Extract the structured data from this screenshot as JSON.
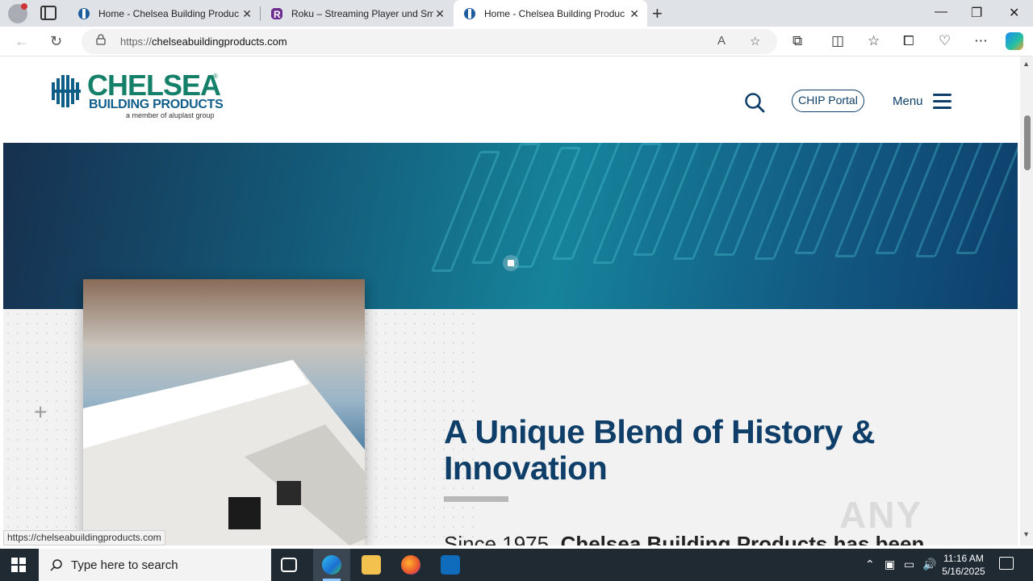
{
  "browser": {
    "tabs": [
      {
        "title": "Home - Chelsea Building Produc",
        "active": false
      },
      {
        "title": "Roku – Streaming Player und Sm",
        "active": false
      },
      {
        "title": "Home - Chelsea Building Produc",
        "active": true
      }
    ],
    "tab_close_glyph": "✕",
    "new_tab_glyph": "+",
    "address": {
      "scheme": "https://",
      "host": "chelseabuildingproducts.com"
    },
    "window_controls": {
      "minimize": "—",
      "restore": "❐",
      "close": "✕"
    },
    "status_url": "https://chelseabuildingproducts.com"
  },
  "site": {
    "logo": {
      "name": "CHELSEA",
      "registered": "®",
      "subtitle": "BUILDING PRODUCTS",
      "tagline": "a member of aluplast group"
    },
    "header": {
      "chip_portal_label": "CHIP Portal",
      "menu_label": "Menu"
    },
    "intro": {
      "headline": "A Unique Blend of History & Innovation",
      "lead_plain": "Since 1975, ",
      "lead_bold": "Chelsea Building Products has been"
    },
    "watermark": "ANY RUN"
  },
  "taskbar": {
    "search_placeholder": "Type here to search",
    "time": "11:16 AM",
    "date": "5/16/2025"
  },
  "colors": {
    "brand_green": "#14806a",
    "brand_navy": "#0f3f69",
    "hero_teal": "#16839b",
    "taskbar": "#1f2a33"
  }
}
